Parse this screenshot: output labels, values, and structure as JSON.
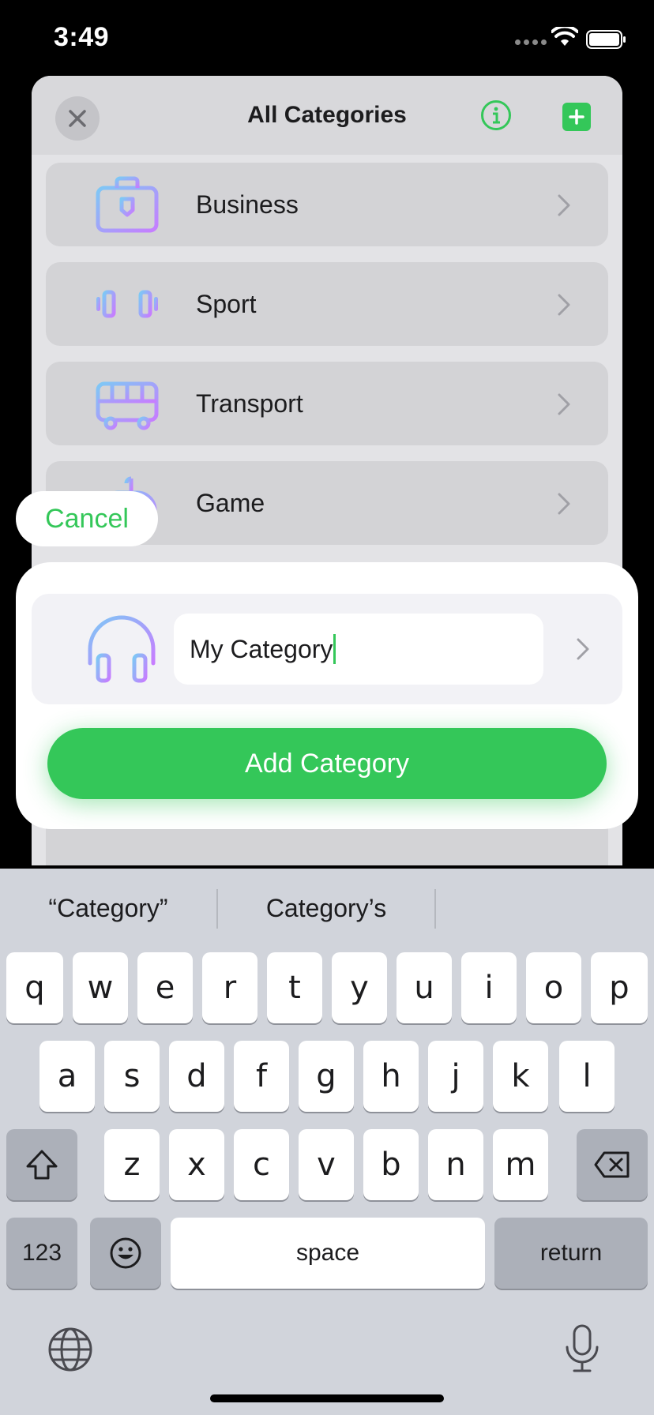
{
  "status_bar": {
    "time": "3:49"
  },
  "sheet": {
    "title": "All Categories",
    "categories": [
      {
        "label": "Business",
        "icon": "briefcase-icon"
      },
      {
        "label": "Sport",
        "icon": "dumbbell-icon"
      },
      {
        "label": "Transport",
        "icon": "bus-icon"
      },
      {
        "label": "Game",
        "icon": "gamepad-icon"
      }
    ]
  },
  "cancel_label": "Cancel",
  "add_card": {
    "icon": "headphones-icon",
    "name_value": "My Category",
    "add_button_label": "Add Category"
  },
  "keyboard": {
    "suggestions": [
      "“Category”",
      "Category’s",
      ""
    ],
    "row1": [
      "q",
      "w",
      "e",
      "r",
      "t",
      "y",
      "u",
      "i",
      "o",
      "p"
    ],
    "row2": [
      "a",
      "s",
      "d",
      "f",
      "g",
      "h",
      "j",
      "k",
      "l"
    ],
    "row3": [
      "z",
      "x",
      "c",
      "v",
      "b",
      "n",
      "m"
    ],
    "numbers_label": "123",
    "space_label": "space",
    "return_label": "return"
  },
  "colors": {
    "accent": "#34c759",
    "icon_gradient_start": "#7ec8f5",
    "icon_gradient_end": "#c77dff"
  }
}
